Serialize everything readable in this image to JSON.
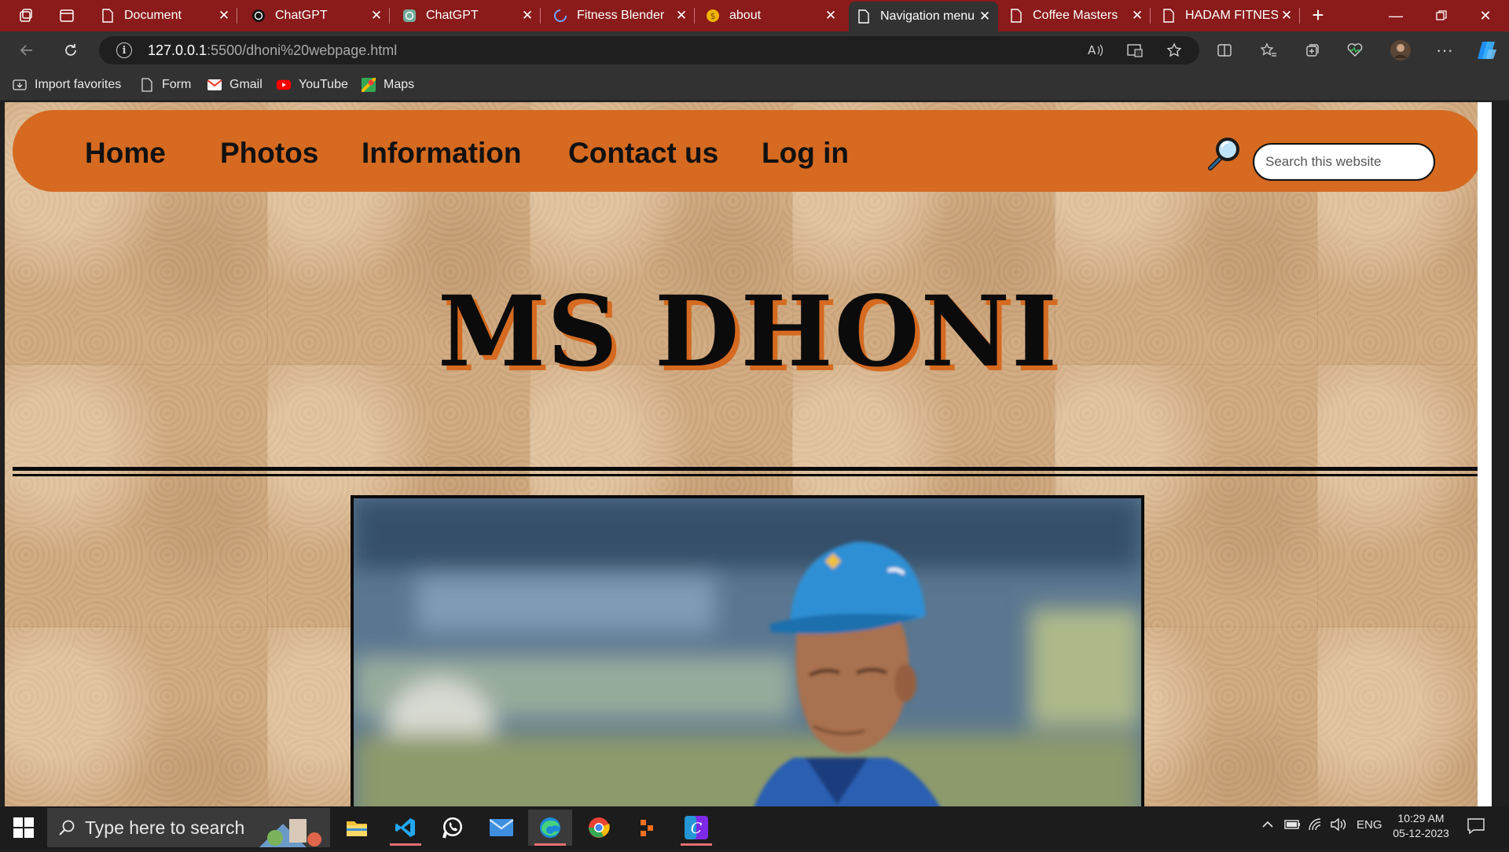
{
  "browser": {
    "tabs": [
      {
        "title": "Document",
        "icon": "page-icon"
      },
      {
        "title": "ChatGPT",
        "icon": "chatgpt-icon"
      },
      {
        "title": "ChatGPT",
        "icon": "chatgpt-green-icon"
      },
      {
        "title": "Fitness Blender",
        "icon": "loading-icon"
      },
      {
        "title": "about",
        "icon": "coin-icon"
      },
      {
        "title": "Navigation menu",
        "icon": "page-icon"
      },
      {
        "title": "Coffee Masters",
        "icon": "page-icon"
      },
      {
        "title": "HADAM FITNESS",
        "icon": "page-icon"
      }
    ],
    "active_tab_index": 5,
    "url_host": "127.0.0.1",
    "url_path": ":5500/dhoni%20webpage.html",
    "favorites": [
      {
        "label": "Import favorites",
        "icon": "import-icon"
      },
      {
        "label": "Form",
        "icon": "page-icon"
      },
      {
        "label": "Gmail",
        "icon": "gmail-icon"
      },
      {
        "label": "YouTube",
        "icon": "youtube-icon"
      },
      {
        "label": "Maps",
        "icon": "maps-icon"
      }
    ]
  },
  "site": {
    "nav": [
      "Home",
      "Photos",
      "Information",
      "Contact us",
      "Log in"
    ],
    "search_placeholder": "Search this website",
    "title": "MS DHONI",
    "accent_color": "#d56a20"
  },
  "taskbar": {
    "search_placeholder": "Type here to search",
    "language": "ENG",
    "time": "10:29 AM",
    "date": "05-12-2023"
  }
}
